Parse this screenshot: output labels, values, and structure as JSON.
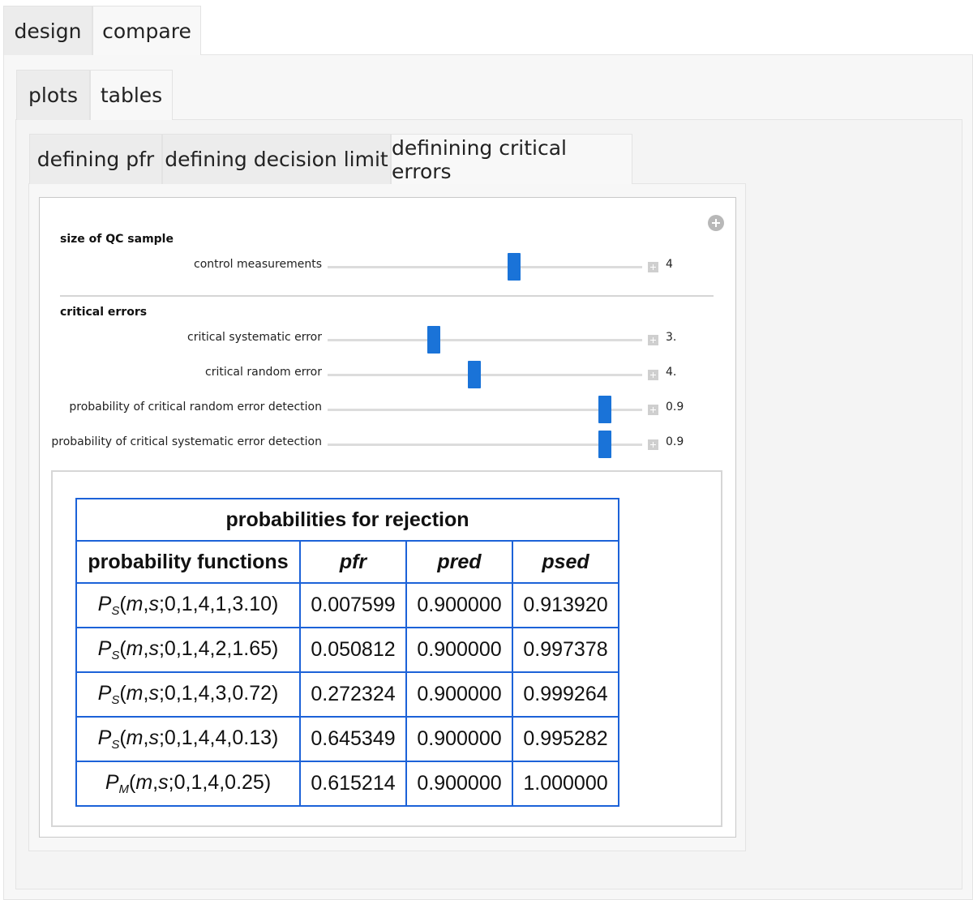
{
  "top_tabs": [
    {
      "label": "design",
      "active": false
    },
    {
      "label": "compare",
      "active": true
    }
  ],
  "sub_tabs": [
    {
      "label": "plots",
      "active": false
    },
    {
      "label": "tables",
      "active": true
    }
  ],
  "inner_tabs": [
    {
      "label": "defining pfr",
      "active": false
    },
    {
      "label": "defining decision limit",
      "active": false
    },
    {
      "label": "definining critical errors",
      "active": true
    }
  ],
  "controls": {
    "qc_section_title": "size of QC sample",
    "control_measurements": {
      "label": "control measurements",
      "value": "4",
      "slider_fraction": 0.59
    },
    "critical_section_title": "critical errors",
    "critical_systematic_error": {
      "label": "critical systematic error",
      "value": "3.",
      "slider_fraction": 0.33
    },
    "critical_random_error": {
      "label": "critical random error",
      "value": "4.",
      "slider_fraction": 0.46
    },
    "prob_random_detection": {
      "label": "probability of critical random error detection",
      "value": "0.9",
      "slider_fraction": 0.88
    },
    "prob_systematic_detection": {
      "label": "probability of critical systematic error detection",
      "value": "0.9",
      "slider_fraction": 0.88
    }
  },
  "table": {
    "caption": "probabilities for rejection",
    "headers": [
      "probability functions",
      "pfr",
      "pred",
      "psed"
    ],
    "rows": [
      {
        "fn": "P",
        "sub": "S",
        "args": "(m,s;0,1,4,1,3.10)",
        "pfr": "0.007599",
        "pred": "0.900000",
        "psed": "0.913920"
      },
      {
        "fn": "P",
        "sub": "S",
        "args": "(m,s;0,1,4,2,1.65)",
        "pfr": "0.050812",
        "pred": "0.900000",
        "psed": "0.997378"
      },
      {
        "fn": "P",
        "sub": "S",
        "args": "(m,s;0,1,4,3,0.72)",
        "pfr": "0.272324",
        "pred": "0.900000",
        "psed": "0.999264"
      },
      {
        "fn": "P",
        "sub": "S",
        "args": "(m,s;0,1,4,4,0.13)",
        "pfr": "0.645349",
        "pred": "0.900000",
        "psed": "0.995282"
      },
      {
        "fn": "P",
        "sub": "M",
        "args": "(m,s;0,1,4,0.25)",
        "pfr": "0.615214",
        "pred": "0.900000",
        "psed": "1.000000"
      }
    ]
  },
  "colors": {
    "slider_thumb": "#1a73d8",
    "table_border": "#1c62d8"
  }
}
